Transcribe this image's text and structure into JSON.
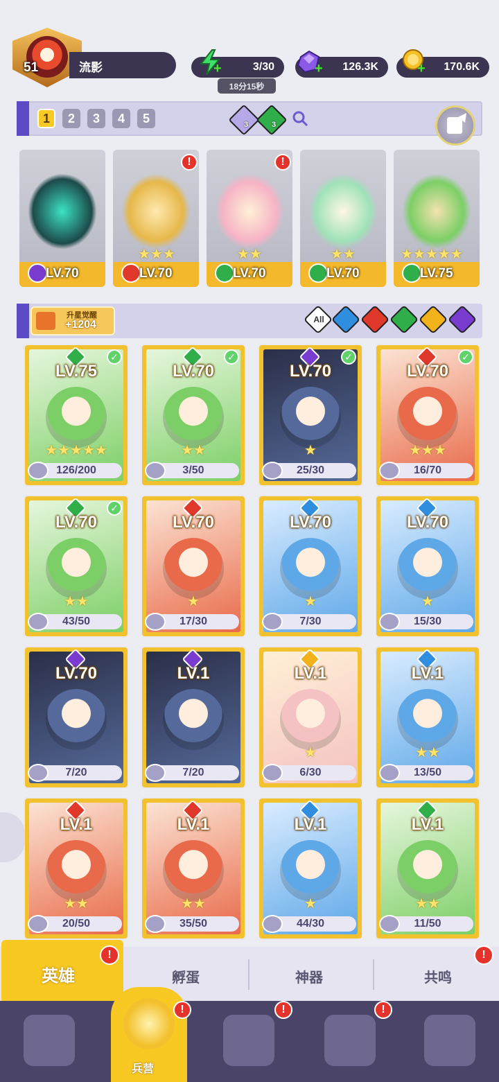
{
  "player": {
    "level": "51",
    "name": "流影"
  },
  "resources": {
    "energy": "3/30",
    "energy_timer": "18分15秒",
    "gems": "126.3K",
    "coins": "170.6K"
  },
  "team_bar": {
    "slots": [
      "1",
      "2",
      "3",
      "4",
      "5"
    ],
    "active_slot": "1",
    "badge_counts": [
      "3",
      "3"
    ]
  },
  "team_cards": [
    {
      "level": "LV.70",
      "element": "dark",
      "stars": "",
      "alert": false
    },
    {
      "level": "LV.70",
      "element": "fire",
      "stars": "★★★",
      "alert": true
    },
    {
      "level": "LV.70",
      "element": "nature",
      "stars": "★★",
      "alert": true
    },
    {
      "level": "LV.70",
      "element": "nature",
      "stars": "★★",
      "alert": false
    },
    {
      "level": "LV.75",
      "element": "nature",
      "stars": "★★★★★",
      "alert": false
    }
  ],
  "awaken": {
    "label": "升星觉醒",
    "value": "+1204"
  },
  "element_filters": [
    "All",
    "water",
    "fire",
    "nature",
    "light",
    "dark"
  ],
  "heroes": [
    {
      "level": "LV.75",
      "element": "nature",
      "progress": "126/200",
      "check": true,
      "stars": "★★★★★"
    },
    {
      "level": "LV.70",
      "element": "nature",
      "progress": "3/50",
      "check": true,
      "stars": "★★"
    },
    {
      "level": "LV.70",
      "element": "dark",
      "progress": "25/30",
      "check": true,
      "stars": "★"
    },
    {
      "level": "LV.70",
      "element": "fire",
      "progress": "16/70",
      "check": true,
      "stars": "★★★"
    },
    {
      "level": "LV.70",
      "element": "nature",
      "progress": "43/50",
      "check": true,
      "stars": "★★"
    },
    {
      "level": "LV.70",
      "element": "fire",
      "progress": "17/30",
      "check": false,
      "stars": "★"
    },
    {
      "level": "LV.70",
      "element": "water",
      "progress": "7/30",
      "check": false,
      "stars": "★"
    },
    {
      "level": "LV.70",
      "element": "water",
      "progress": "15/30",
      "check": false,
      "stars": "★"
    },
    {
      "level": "LV.70",
      "element": "dark",
      "progress": "7/20",
      "check": false,
      "stars": ""
    },
    {
      "level": "LV.1",
      "element": "dark",
      "progress": "7/20",
      "check": false,
      "stars": ""
    },
    {
      "level": "LV.1",
      "element": "light",
      "progress": "6/30",
      "check": false,
      "stars": "★"
    },
    {
      "level": "LV.1",
      "element": "water",
      "progress": "13/50",
      "check": false,
      "stars": "★★"
    },
    {
      "level": "LV.1",
      "element": "fire",
      "progress": "20/50",
      "check": false,
      "stars": "★★"
    },
    {
      "level": "LV.1",
      "element": "fire",
      "progress": "35/50",
      "check": false,
      "stars": "★★"
    },
    {
      "level": "LV.1",
      "element": "water",
      "progress": "44/30",
      "check": false,
      "stars": "★"
    },
    {
      "level": "LV.1",
      "element": "nature",
      "progress": "11/50",
      "check": false,
      "stars": "★★"
    }
  ],
  "tabs": {
    "heroes": "英雄",
    "hatch": "孵蛋",
    "artifact": "神器",
    "resonance": "共鸣"
  },
  "nav": {
    "barracks": "兵营"
  },
  "alert_mark": "!",
  "check_mark": "✓",
  "colors": {
    "fire": "#e0382a",
    "water": "#2f8ee0",
    "nature": "#2fae4a",
    "dark": "#7a3cd0",
    "light": "#f2b21c",
    "accent": "#f8c923",
    "panel": "#3b3552"
  }
}
